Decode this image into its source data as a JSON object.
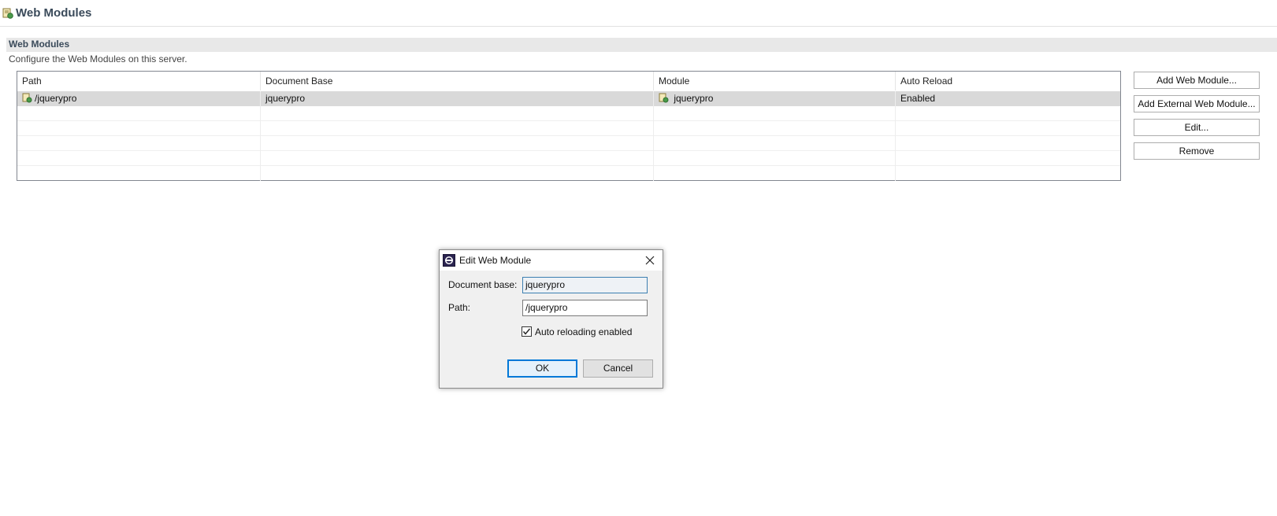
{
  "header": {
    "title": "Web Modules",
    "icon": "server-module-icon"
  },
  "section": {
    "title": "Web Modules",
    "description": "Configure the Web Modules on this server."
  },
  "table": {
    "columns": [
      "Path",
      "Document Base",
      "Module",
      "Auto Reload"
    ],
    "rows": [
      {
        "path": "/jquerypro",
        "document_base": "jquerypro",
        "module": "jquerypro",
        "auto_reload": "Enabled",
        "selected": true
      }
    ]
  },
  "buttons": {
    "add_web_module": "Add Web Module...",
    "add_external_web_module": "Add External Web Module...",
    "edit": "Edit...",
    "remove": "Remove"
  },
  "dialog": {
    "title": "Edit Web Module",
    "document_base_label": "Document base:",
    "document_base_value": "jquerypro",
    "path_label": "Path:",
    "path_value": "/jquerypro",
    "auto_reload_label": "Auto reloading enabled",
    "auto_reload_checked": true,
    "ok": "OK",
    "cancel": "Cancel"
  },
  "colors": {
    "selection": "#d9d9d9",
    "accent": "#0078d7",
    "header_text": "#3a4a5a"
  }
}
